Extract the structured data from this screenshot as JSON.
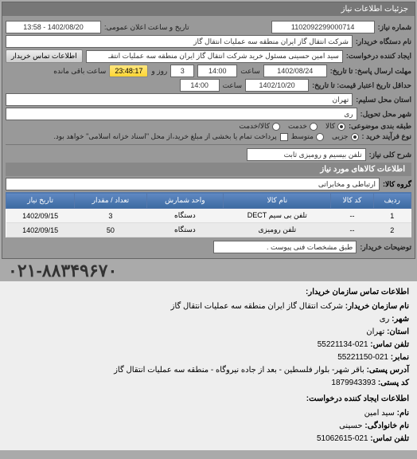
{
  "header": {
    "title": "جزئیات اطلاعات نیاز"
  },
  "fields": {
    "number_label": "شماره نیاز:",
    "number_value": "1102092299000714",
    "announce_label": "تاریخ و ساعت اعلان عمومی:",
    "announce_value": "1402/08/20 - 13:58",
    "org_label": "نام دستگاه خریدار:",
    "org_value": "شرکت انتقال گاز ایران منطقه سه عملیات انتقال گاز",
    "requester_label": "ایجاد کننده درخواست:",
    "requester_value": "سید امین حسینی مسئول خرید شرکت انتقال گاز ایران منطقه سه عملیات انتقـ",
    "contact_btn": "اطلاعات تماس خریدار",
    "deadline_label": "مهلت ارسال پاسخ: تا تاریخ:",
    "deadline_date": "1402/08/24",
    "time_label": "ساعت",
    "deadline_time": "14:00",
    "days_remaining": "3",
    "days_label": "روز و",
    "time_remaining": "23:48:17",
    "remaining_label": "ساعت باقی مانده",
    "validity_label": "حداقل تاریخ اعتبار قیمت: تا تاریخ:",
    "validity_date": "1402/10/20",
    "validity_time": "14:00",
    "province_label": "استان محل تسلیم:",
    "province_value": "تهران",
    "city_label": "شهر محل تحویل:",
    "city_value": "ری",
    "category_label": "طبقه بندی موضوعی:",
    "product_option": "کالا",
    "service_option": "خدمت",
    "product_service_option": "کالا/خدمت",
    "type_label": "نوع فرآیند خرید :",
    "minor_option": "جزیی",
    "medium_option": "متوسط",
    "payment_note": "پرداخت تمام یا بخشی از مبلغ خرید،از محل \"اسناد خزانه اسلامی\" خواهد بود.",
    "need_title_label": "شرح کلی نیاز:",
    "need_title_value": "تلفن بیسیم و رومیزی ثابت",
    "items_section": "اطلاعات کالاهای مورد نیاز",
    "group_label": "گروه کالا:",
    "group_value": "ارتباطی و مخابراتی",
    "desc_label": "توضیحات خریدار:",
    "desc_value": "طبق مشخصات فنی پیوست ."
  },
  "table": {
    "headers": [
      "ردیف",
      "کد کالا",
      "نام کالا",
      "واحد شمارش",
      "تعداد / مقدار",
      "تاریخ نیاز"
    ],
    "rows": [
      {
        "idx": "1",
        "code": "--",
        "name": "تلفن بی سیم DECT",
        "unit": "دستگاه",
        "qty": "3",
        "date": "1402/09/15"
      },
      {
        "idx": "2",
        "code": "--",
        "name": "تلفن رومیزی",
        "unit": "دستگاه",
        "qty": "50",
        "date": "1402/09/15"
      }
    ]
  },
  "contact": {
    "big_phone": "۰۲۱-۸۸۳۴۹۶۷۰",
    "section1_title": "اطلاعات تماس سازمان خریدار:",
    "org_name_label": "نام سازمان خریدار:",
    "org_name": "شرکت انتقال گاز ایران منطقه سه عملیات انتقال گاز",
    "city_label": "شهر:",
    "city": "ری",
    "province_label": "استان:",
    "province": "تهران",
    "phone_label": "تلفن تماس:",
    "phone": "021-55221134",
    "fax_label": "نمابر:",
    "fax": "021-55221150",
    "address_label": "آدرس پستی:",
    "address": "باقر شهر- بلوار فلسطین - بعد از جاده نیروگاه - منطقه سه عملیات انتقال گاز",
    "postal_label": "کد پستی:",
    "postal": "1879943393",
    "section2_title": "اطلاعات ایجاد کننده درخواست:",
    "name_label": "نام:",
    "name": "سید امین",
    "family_label": "نام خانوادگی:",
    "family": "حسینی",
    "phone2_label": "تلفن تماس:",
    "phone2": "021-51062615"
  }
}
